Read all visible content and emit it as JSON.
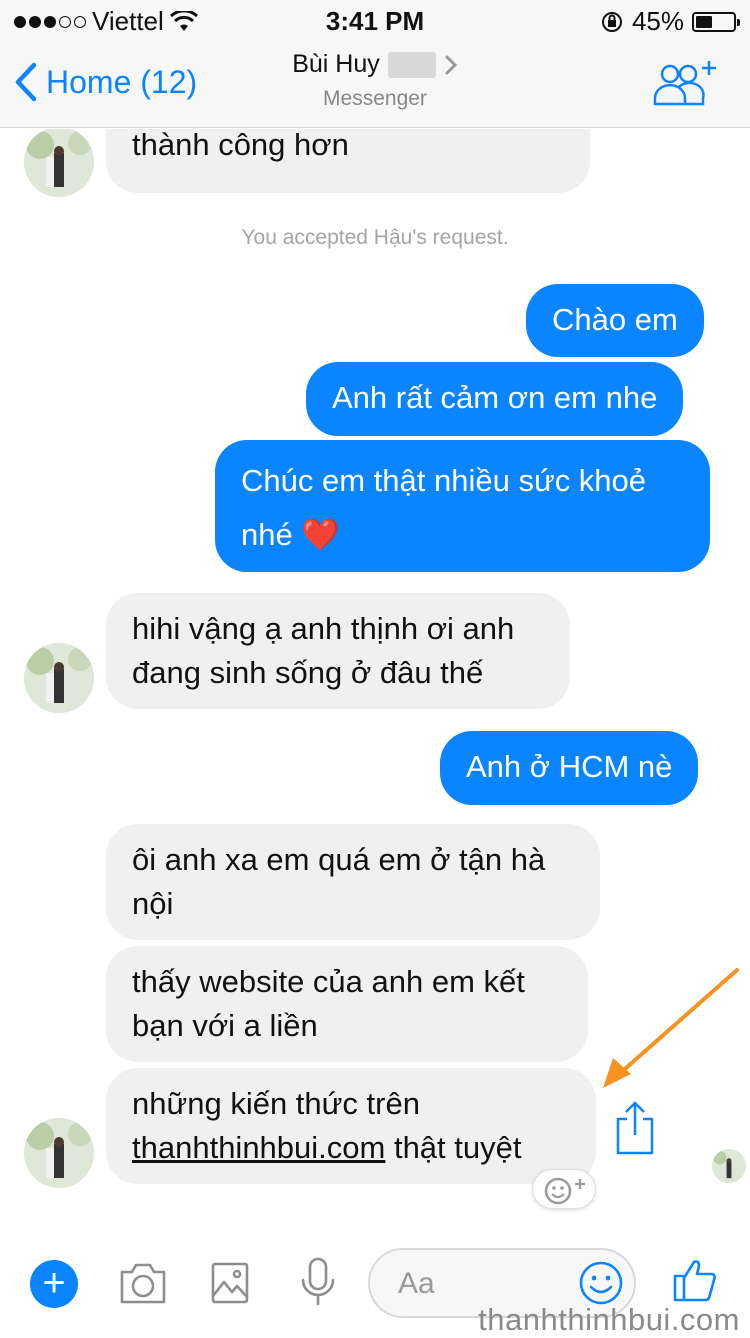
{
  "status_bar": {
    "carrier": "Viettel",
    "time": "3:41 PM",
    "battery": "45%",
    "battery_level": 0.45
  },
  "header": {
    "back_label": "Home (12)",
    "title": "Bùi Huy",
    "subtitle": "Messenger"
  },
  "messages": [
    {
      "direction": "in",
      "text": "thành công hơn"
    },
    {
      "direction": "system",
      "text": "You accepted Hậu's request."
    },
    {
      "direction": "out",
      "text": "Chào em"
    },
    {
      "direction": "out",
      "text": "Anh rất cảm ơn em nhe"
    },
    {
      "direction": "out",
      "line1": "Chúc em thật nhiều sức khoẻ",
      "line2": "nhé",
      "emoji": "heart"
    },
    {
      "direction": "in",
      "line1": "hihi vậng ạ anh thịnh ơi anh",
      "line2": "đang sinh sống ở đâu thế"
    },
    {
      "direction": "out",
      "text": "Anh ở HCM nè"
    },
    {
      "direction": "in",
      "line1": "ôi anh xa em quá em ở tận hà",
      "line2": "nội"
    },
    {
      "direction": "in",
      "line1": "thấy website của anh em kết",
      "line2": "bạn với a liền"
    },
    {
      "direction": "in",
      "line1": "những kiến thức trên",
      "link": "thanhthinhbui.com",
      "line2_rest": " thật tuyệt"
    }
  ],
  "composer": {
    "placeholder": "Aa"
  },
  "watermark": "thanhthinhbui.com",
  "colors": {
    "accent": "#0b84ff",
    "incoming_bubble": "#f0f0f0",
    "annotation_arrow": "#f7931e"
  }
}
